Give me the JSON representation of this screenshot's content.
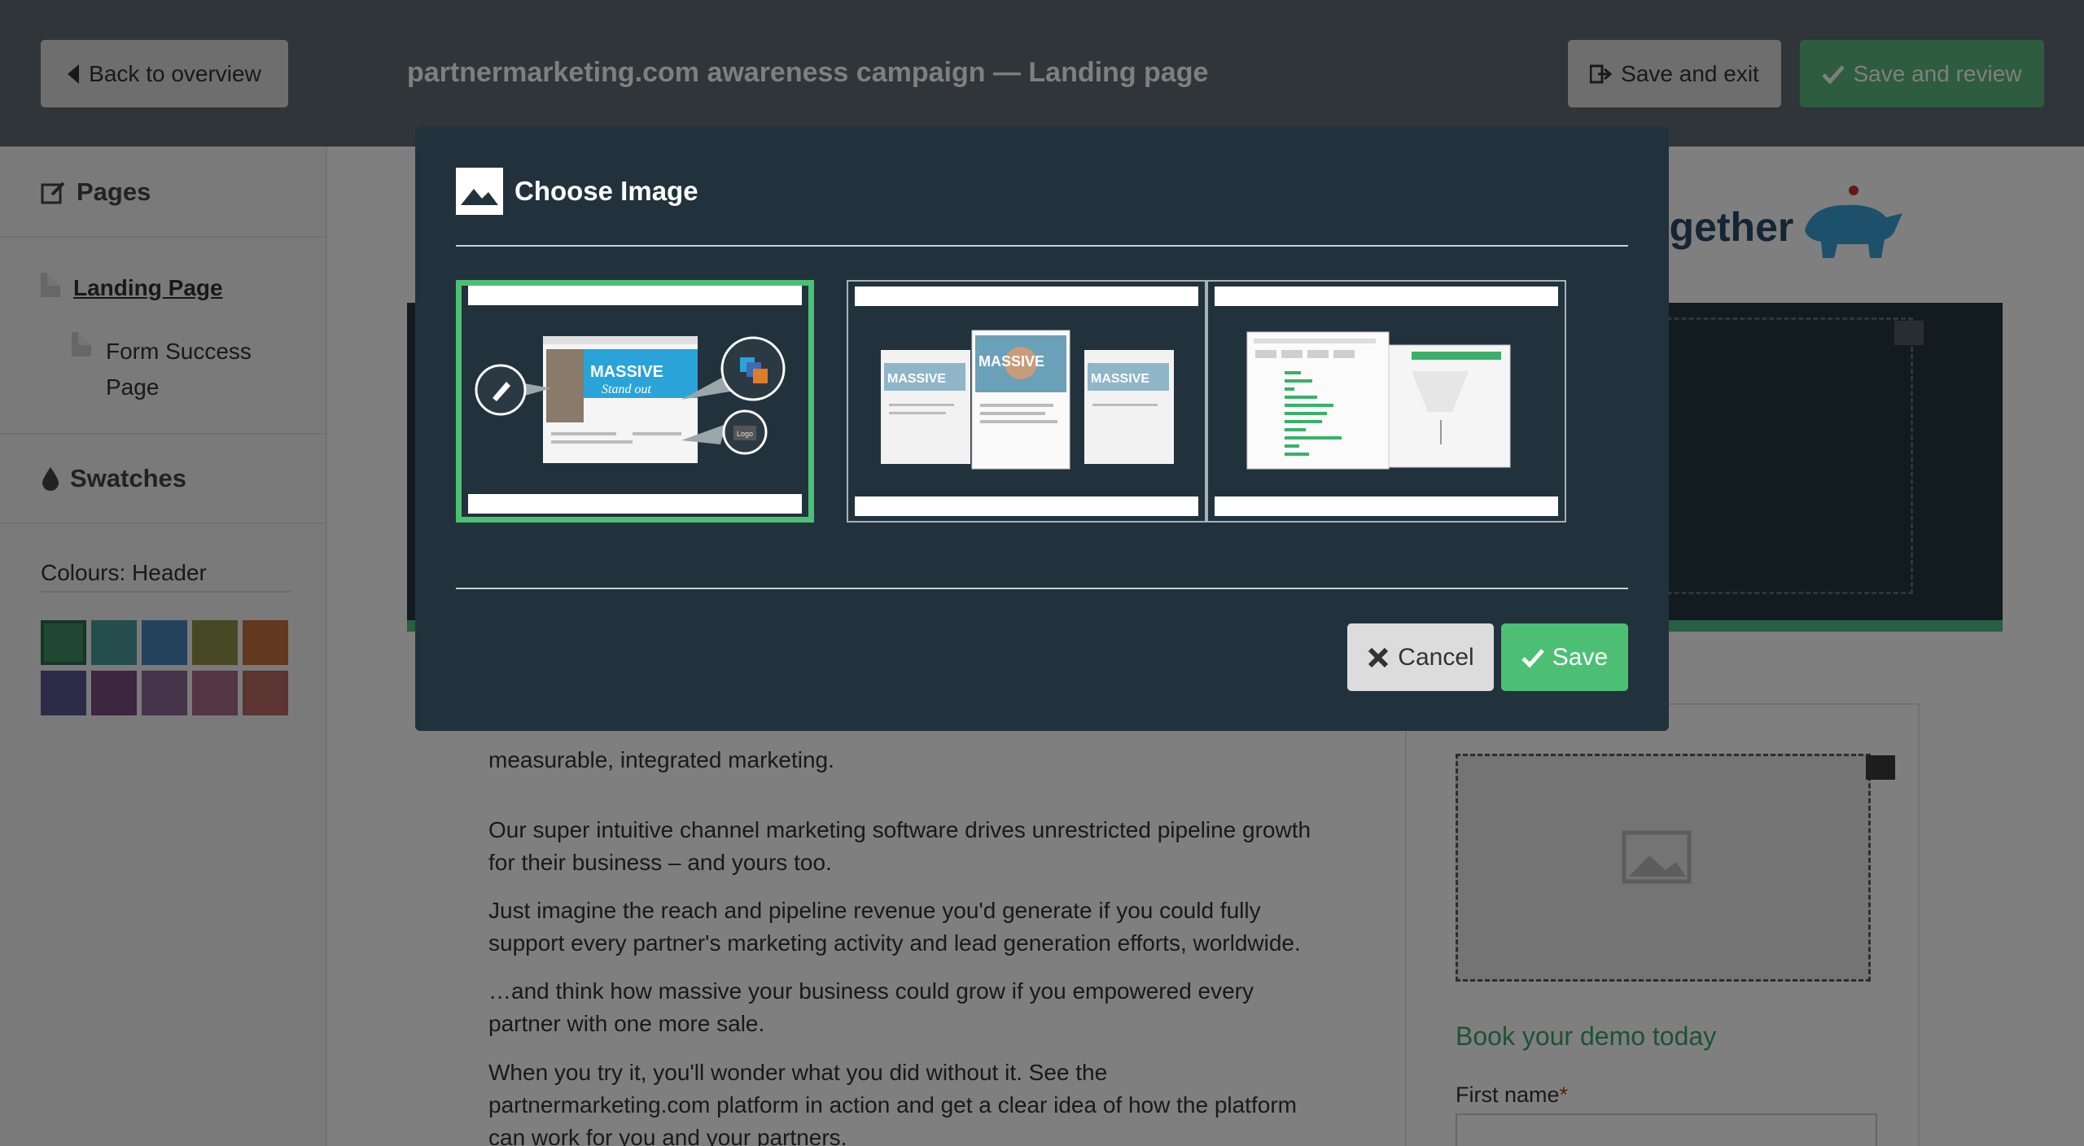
{
  "header": {
    "back_label": "Back to overview",
    "title": "partnermarketing.com awareness campaign — Landing page",
    "save_exit_label": "Save and exit",
    "save_review_label": "Save and review",
    "back_icon": "arrow-left-icon",
    "save_exit_icon": "sign-out-icon",
    "save_review_icon": "checkmark-icon"
  },
  "sidebar": {
    "pages_title": "Pages",
    "pages": [
      {
        "label": "Landing Page",
        "active": true
      },
      {
        "label": "Form Success Page",
        "active": false
      }
    ],
    "swatches_title": "Swatches",
    "colours_label": "Colours: Header",
    "swatch_colors": [
      "#3e8e68",
      "#4a9a9a",
      "#4a84bb",
      "#8e9248",
      "#c4703c",
      "#5a5690",
      "#7a4c80",
      "#8c6a94",
      "#a86a84",
      "#b86864"
    ]
  },
  "page": {
    "logo_text": "ogether",
    "paragraph_partial": "measurable, integrated marketing.",
    "paragraphs": [
      "Our super intuitive channel marketing software drives unrestricted pipeline growth for their business – and yours too.",
      "Just imagine the reach and pipeline revenue you'd generate if you could fully support every partner's marketing activity and lead generation efforts, worldwide.",
      "…and think how massive your business could grow if you empowered every partner with one more sale.",
      "When you try it, you'll wonder what you did without it. See the partnermarketing.com platform in action and get a clear idea of how the platform can work for you and your partners."
    ],
    "form_heading": "Book your demo today",
    "first_name_label": "First name",
    "required_marker": "*"
  },
  "modal": {
    "title": "Choose Image",
    "title_icon": "image-icon",
    "thumbnails": [
      {
        "name": "image-option-1",
        "selected": true,
        "text": [
          "MASSIVE",
          "Stand out",
          "Logo"
        ]
      },
      {
        "name": "image-option-2",
        "selected": false,
        "text": [
          "MASSIVE",
          "MASSIVE",
          "MASSIVE"
        ]
      },
      {
        "name": "image-option-3",
        "selected": false,
        "text": []
      }
    ],
    "cancel_label": "Cancel",
    "save_label": "Save",
    "cancel_icon": "close-icon",
    "save_icon": "checkmark-icon"
  },
  "colors": {
    "accent_green": "#4cbf74",
    "modal_bg": "#22323c",
    "header_bg": "#5f6a73"
  }
}
